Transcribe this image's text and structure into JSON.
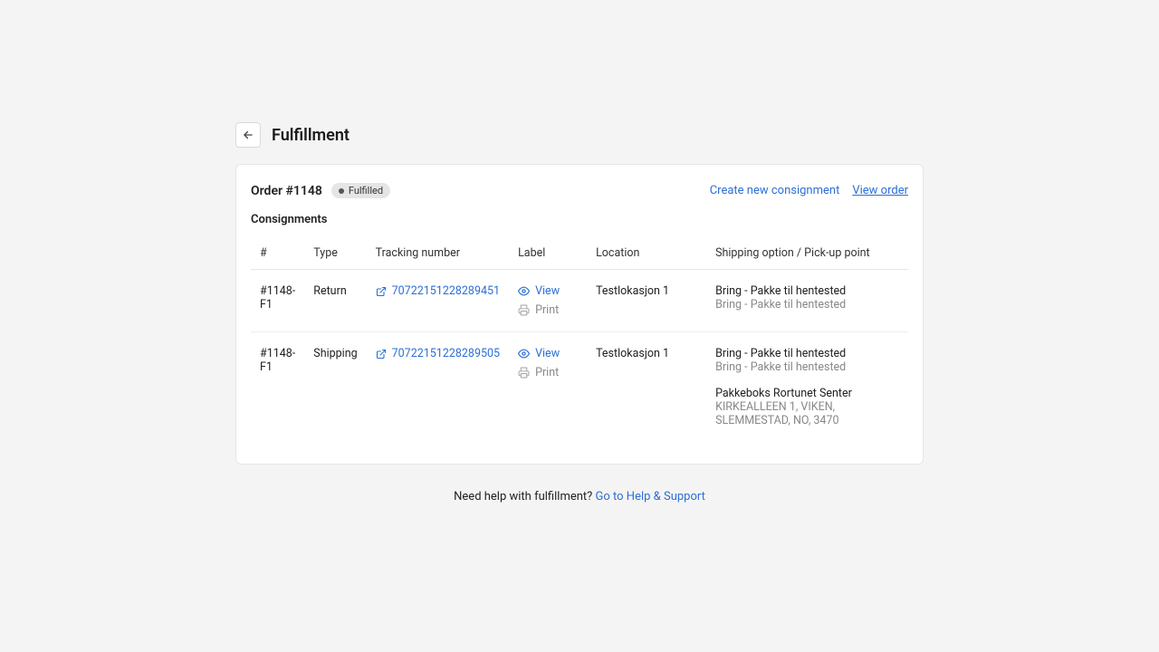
{
  "header": {
    "title": "Fulfillment"
  },
  "card": {
    "order_label": "Order #1148",
    "badge": "Fulfilled",
    "actions": {
      "create": "Create new consignment",
      "view_order": "View order"
    },
    "section_title": "Consignments"
  },
  "table": {
    "headers": {
      "id": "#",
      "type": "Type",
      "tracking": "Tracking number",
      "label": "Label",
      "location": "Location",
      "shipping": "Shipping option / Pick-up point"
    },
    "labels": {
      "view": "View",
      "print": "Print"
    },
    "rows": [
      {
        "id": "#1148-F1",
        "type": "Return",
        "tracking": "70722151228289451",
        "location": "Testlokasjon 1",
        "ship_primary": "Bring - Pakke til hentested",
        "ship_secondary": "Bring - Pakke til hentested",
        "pickup_name": "",
        "pickup_addr": ""
      },
      {
        "id": "#1148-F1",
        "type": "Shipping",
        "tracking": "70722151228289505",
        "location": "Testlokasjon 1",
        "ship_primary": "Bring - Pakke til hentested",
        "ship_secondary": "Bring - Pakke til hentested",
        "pickup_name": "Pakkeboks Rortunet Senter",
        "pickup_addr": "KIRKEALLEEN 1, VIKEN, SLEMMESTAD, NO, 3470"
      }
    ]
  },
  "footer": {
    "prompt": "Need help with fulfillment? ",
    "link": "Go to Help & Support"
  }
}
